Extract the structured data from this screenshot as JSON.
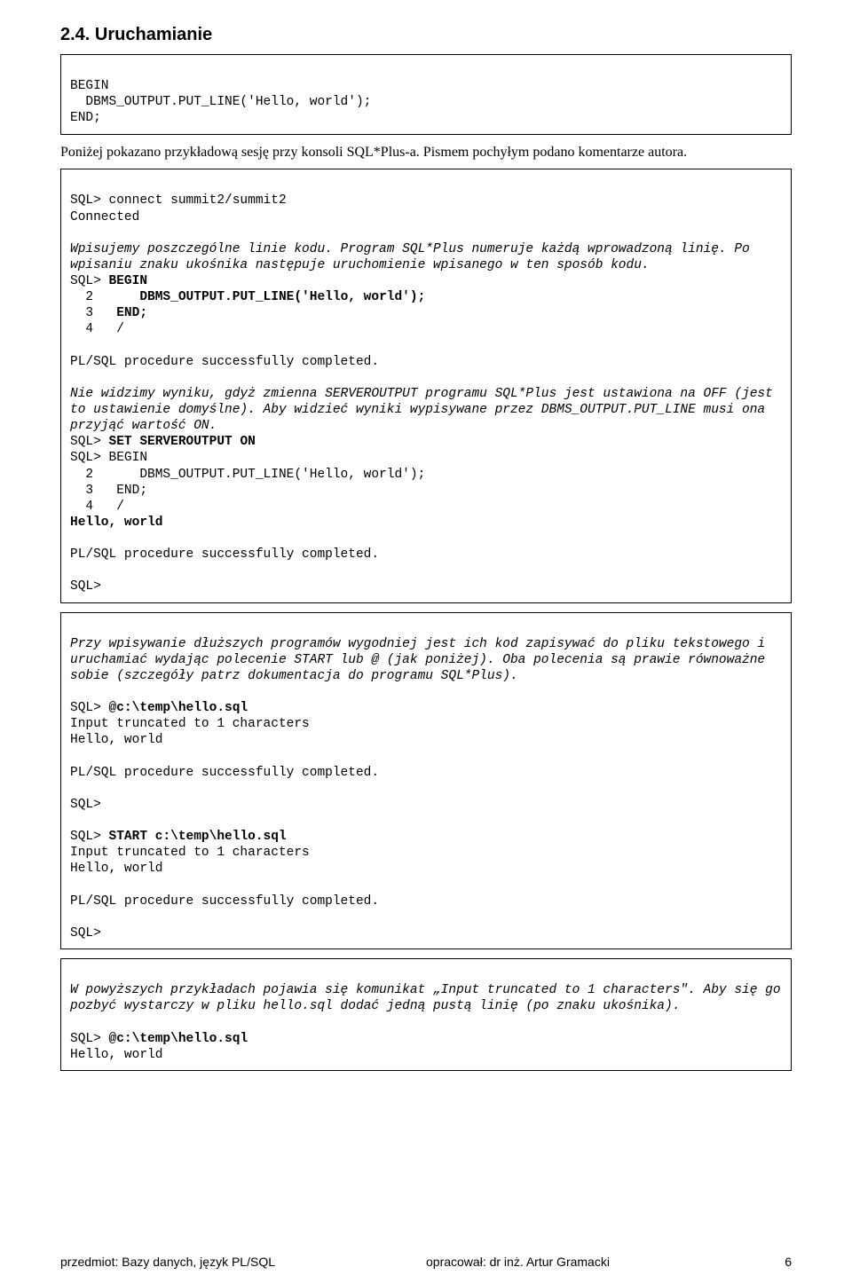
{
  "section_heading": "2.4. Uruchamianie",
  "box1": {
    "l1": "BEGIN",
    "l2": "  DBMS_OUTPUT.PUT_LINE('Hello, world');",
    "l3": "END;"
  },
  "para1": "Poniżej pokazano przykładową sesję przy konsoli SQL*Plus-a. Pismem pochyłym podano komentarze autora.",
  "box2": {
    "l1": "SQL> connect summit2/summit2",
    "l2": "Connected",
    "l3": "Wpisujemy poszczególne linie kodu. Program SQL*Plus numeruje każdą wprowadzoną linię. Po wpisaniu znaku ukośnika następuje uruchomienie wpisanego w ten sposób kodu.",
    "l4a": "SQL> ",
    "l4b": "BEGIN",
    "l5a": "  2      ",
    "l5b": "DBMS_OUTPUT.PUT_LINE('Hello, world');",
    "l6a": "  3   ",
    "l6b": "END;",
    "l7": "  4   /",
    "l8": "PL/SQL procedure successfully completed.",
    "l9": "Nie widzimy wyniku, gdyż zmienna SERVEROUTPUT programu SQL*Plus jest ustawiona na OFF (jest to ustawienie domyślne). Aby widzieć wyniki wypisywane przez DBMS_OUTPUT.PUT_LINE musi ona przyjąć wartość ON.",
    "l10a": "SQL> ",
    "l10b": "SET SERVEROUTPUT ON",
    "l11": "SQL> BEGIN",
    "l12": "  2      DBMS_OUTPUT.PUT_LINE('Hello, world');",
    "l13": "  3   END;",
    "l14": "  4   /",
    "l15": "Hello, world",
    "l16": "PL/SQL procedure successfully completed.",
    "l17": "SQL>"
  },
  "box3": {
    "l1": "Przy wpisywanie dłuższych programów wygodniej jest ich kod zapisywać do pliku tekstowego i uruchamiać wydając polecenie START lub @ (jak poniżej). Oba polecenia są prawie równoważne sobie (szczegóły patrz dokumentacja do programu SQL*Plus).",
    "l2a": "SQL> ",
    "l2b": "@c:\\temp\\hello.sql",
    "l3": "Input truncated to 1 characters",
    "l4": "Hello, world",
    "l5": "PL/SQL procedure successfully completed.",
    "l6": "SQL>",
    "l7a": "SQL> ",
    "l7b": "START c:\\temp\\hello.sql",
    "l8": "Input truncated to 1 characters",
    "l9": "Hello, world",
    "l10": "PL/SQL procedure successfully completed.",
    "l11": "SQL>"
  },
  "box4": {
    "l1": "W powyższych przykładach pojawia się komunikat „Input truncated to 1 characters\". Aby się go pozbyć wystarczy w pliku hello.sql dodać jedną pustą linię (po znaku ukośnika).",
    "l2a": "SQL> ",
    "l2b": "@c:\\temp\\hello.sql",
    "l3": "Hello, world"
  },
  "footer": {
    "left": "przedmiot: Bazy danych, język PL/SQL",
    "mid": "opracował: dr inż. Artur Gramacki",
    "right": "6"
  }
}
